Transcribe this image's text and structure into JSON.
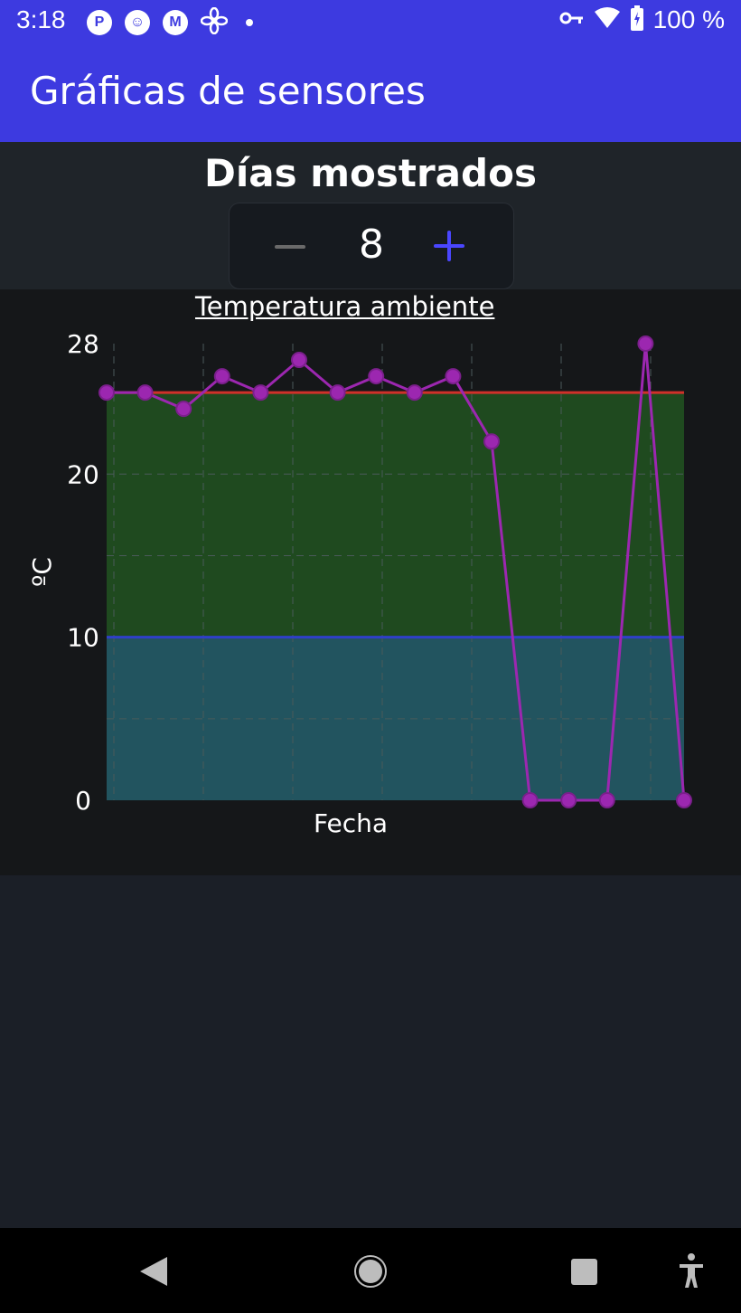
{
  "status_bar": {
    "time": "3:18",
    "left_icons": [
      "p-icon",
      "notification-face-icon",
      "m-icon",
      "fan-icon"
    ],
    "battery_percent": "100 %"
  },
  "app_bar": {
    "title": "Gráficas de sensores"
  },
  "days_control": {
    "title": "Días mostrados",
    "value": "8"
  },
  "chart_data": {
    "type": "line",
    "title": "Temperatura ambiente",
    "xlabel": "Fecha",
    "ylabel": "ºC",
    "yticks": [
      0,
      10,
      20,
      28
    ],
    "ylim": [
      0,
      28
    ],
    "threshold_high": 25,
    "threshold_low": 10,
    "series": [
      {
        "values": [
          25,
          25,
          24,
          26,
          25,
          27,
          25,
          26,
          25,
          26,
          22,
          0,
          0,
          0,
          28,
          0
        ]
      }
    ],
    "colors": {
      "line": "#9c27b0",
      "high": "#d0302a",
      "low": "#2f3fc9",
      "good_band": "#1f4a1f",
      "cold_band": "#22545f"
    }
  },
  "nav_bar": {
    "items": [
      "back-icon",
      "home-icon",
      "recents-icon",
      "accessibility-icon"
    ]
  }
}
